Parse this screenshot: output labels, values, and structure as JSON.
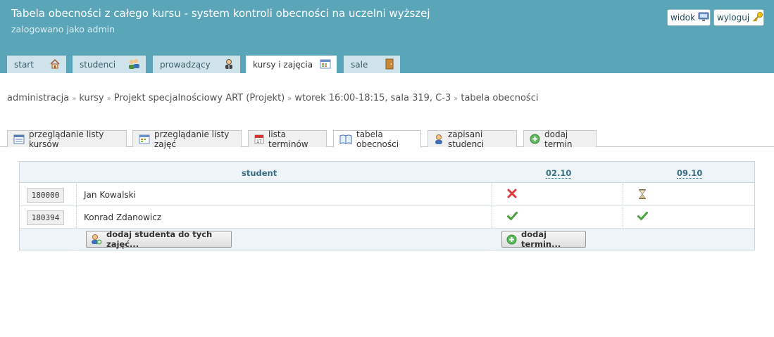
{
  "app": {
    "title": "Tabela obecności z całego kursu - system kontroli obecności na uczelni wyższej",
    "login_info": "zalogowano jako admin",
    "view_button": "widok",
    "logout_button": "wyloguj"
  },
  "nav": {
    "tabs": [
      {
        "label": "start",
        "icon": "home-icon"
      },
      {
        "label": "studenci",
        "icon": "students-icon"
      },
      {
        "label": "prowadzący",
        "icon": "teacher-icon"
      },
      {
        "label": "kursy i zajęcia",
        "icon": "calendar-icon",
        "active": true
      },
      {
        "label": "sale",
        "icon": "door-icon"
      }
    ]
  },
  "breadcrumb": {
    "items": [
      "administracja",
      "kursy",
      "Projekt specjalnościowy ART (Projekt)",
      "wtorek 16:00-18:15, sala 319, C-3",
      "tabela obecności"
    ],
    "separator": "»"
  },
  "subtabs": [
    {
      "label": "przeglądanie listy kursów",
      "icon": "list-icon"
    },
    {
      "label": "przeglądanie listy zajęć",
      "icon": "calendar-grid-icon"
    },
    {
      "label": "lista terminów",
      "icon": "date-icon"
    },
    {
      "label": "tabela obecności",
      "icon": "book-icon",
      "active": true
    },
    {
      "label": "zapisani studenci",
      "icon": "user-icon"
    },
    {
      "label": "dodaj termin",
      "icon": "add-icon"
    }
  ],
  "table": {
    "header_student": "student",
    "dates": [
      "02.10",
      "09.10"
    ],
    "rows": [
      {
        "id": "180000",
        "name": "Jan Kowalski",
        "marks": [
          "absent",
          "pending"
        ]
      },
      {
        "id": "180394",
        "name": "Konrad Zdanowicz",
        "marks": [
          "present",
          "present"
        ]
      }
    ],
    "add_student_button": "dodaj studenta do tych zajęć...",
    "add_date_button": "dodaj termin..."
  },
  "colors": {
    "header_bg": "#5ba5b8",
    "nav_tab_bg": "#cfe4ea",
    "absent": "#e0393e",
    "present": "#4aa33c"
  }
}
